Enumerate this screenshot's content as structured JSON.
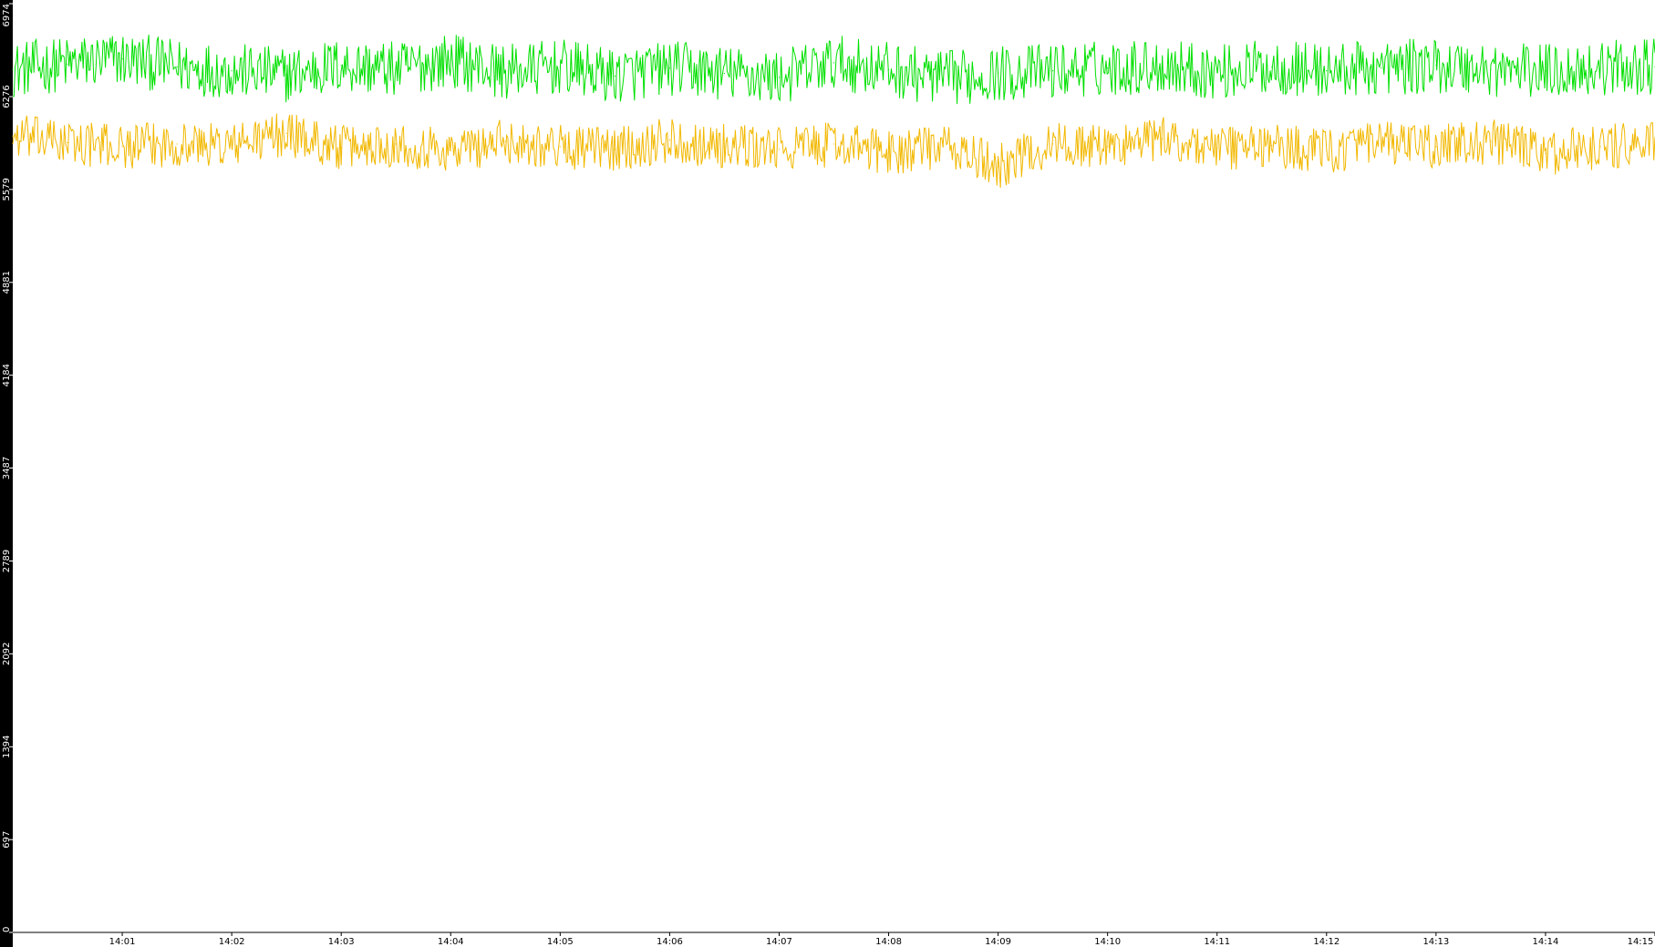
{
  "chart_data": {
    "type": "line",
    "title": "",
    "xlabel": "",
    "ylabel": "",
    "ylim": [
      0,
      6974
    ],
    "xlim": [
      "14:00",
      "14:15"
    ],
    "grid": false,
    "legend": "none",
    "y_ticks": [
      "0",
      "697",
      "1394",
      "2092",
      "2789",
      "3487",
      "4184",
      "4881",
      "5579",
      "6276",
      "6974"
    ],
    "x_ticks": [
      "14:01",
      "14:02",
      "14:03",
      "14:04",
      "14:05",
      "14:06",
      "14:07",
      "14:08",
      "14:09",
      "14:10",
      "14:11",
      "14:12",
      "14:13",
      "14:14",
      "14:15"
    ],
    "series": [
      {
        "color": "#00e000",
        "x": [
          "14:00",
          "14:00:30",
          "14:01",
          "14:01:30",
          "14:02",
          "14:02:30",
          "14:03",
          "14:03:30",
          "14:04",
          "14:04:30",
          "14:05",
          "14:05:30",
          "14:06",
          "14:06:30",
          "14:07",
          "14:07:30",
          "14:08",
          "14:08:30",
          "14:09",
          "14:09:30",
          "14:10",
          "14:10:30",
          "14:11",
          "14:11:30",
          "14:12",
          "14:12:30",
          "14:13",
          "14:13:30",
          "14:14",
          "14:14:30",
          "14:15"
        ],
        "values": [
          6480,
          6520,
          6560,
          6500,
          6470,
          6440,
          6510,
          6480,
          6550,
          6460,
          6500,
          6430,
          6490,
          6450,
          6420,
          6530,
          6480,
          6410,
          6450,
          6470,
          6490,
          6510,
          6460,
          6500,
          6470,
          6490,
          6510,
          6480,
          6470,
          6490,
          6500
        ]
      },
      {
        "color": "#f2b800",
        "x": [
          "14:00",
          "14:00:30",
          "14:01",
          "14:01:30",
          "14:02",
          "14:02:30",
          "14:03",
          "14:03:30",
          "14:04",
          "14:04:30",
          "14:05",
          "14:05:30",
          "14:06",
          "14:06:30",
          "14:07",
          "14:07:30",
          "14:08",
          "14:08:30",
          "14:09",
          "14:09:30",
          "14:10",
          "14:10:30",
          "14:11",
          "14:11:30",
          "14:12",
          "14:12:30",
          "14:13",
          "14:13:30",
          "14:14",
          "14:14:30",
          "14:15"
        ],
        "values": [
          5980,
          5930,
          5900,
          5920,
          5910,
          6000,
          5890,
          5920,
          5870,
          5940,
          5900,
          5880,
          5950,
          5900,
          5880,
          5920,
          5860,
          5900,
          5750,
          5920,
          5900,
          5960,
          5890,
          5910,
          5870,
          5920,
          5900,
          5940,
          5850,
          5900,
          5920
        ]
      }
    ]
  }
}
